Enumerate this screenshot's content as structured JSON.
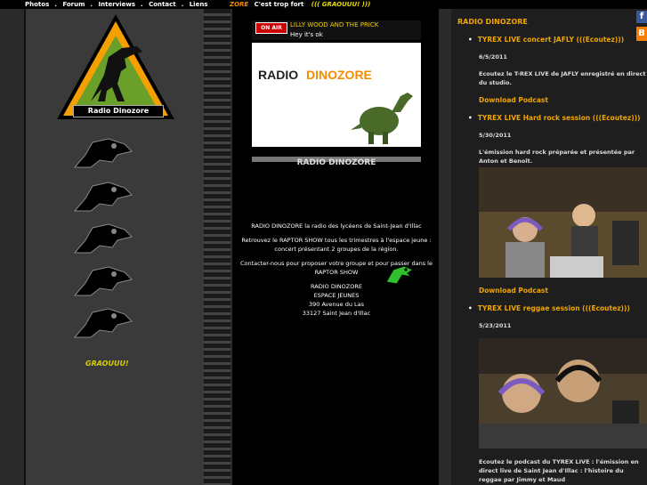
{
  "nav": {
    "items": [
      "Photos",
      "Forum",
      "Interviews",
      "Contact",
      "Liens"
    ],
    "separator": "."
  },
  "ticker": {
    "brand": "ZORE",
    "slogan": "C'est trop fort",
    "shout": "((( GRAOUUU! )))"
  },
  "left": {
    "logo_label": "Radio Dinozore",
    "graou": "GRAOUUU!"
  },
  "player": {
    "onair": "ON AIR",
    "track": "LILLY WOOD AND THE PRICK",
    "track_sub": "Hey it's ok"
  },
  "banner": {
    "word1": "RADIO",
    "word2": "DINOZORE",
    "caption": "RADIO DINOZORE"
  },
  "about": {
    "line1": "RADIO DINOZORE la radio des lycéens de Saint-Jean d'Illac",
    "line2": "Retrouvez le RAPTOR SHOW tous les trimestres à l'espace jeune : concert présentant 2 groupes de la région.",
    "line3": "Contacter-nous pour proposer votre groupe et pour passer dans le RAPTOR SHOW",
    "addr1": "RADIO DINOZORE",
    "addr2": "ESPACE JEUNES",
    "addr3": "390 Avenue du Las",
    "addr4": "33127 Saint Jean d'Illac"
  },
  "feed": {
    "title": "RADIO DINOZORE",
    "posts": [
      {
        "title": "TYREX LIVE concert JAFLY (((Ecoutez)))",
        "date": "6/5/2011",
        "text": "Ecoutez le T-REX LIVE de JAFLY enregistré en direct du studio.",
        "link": "Download Podcast"
      },
      {
        "title": "TYREX LIVE Hard rock session (((Ecoutez)))",
        "date": "5/30/2011",
        "text": "L'émission hard rock préparée et présentée par Anton et Benoît.",
        "link": "Download Podcast"
      },
      {
        "title": "TYREX LIVE reggae session (((Ecoutez)))",
        "date": "5/23/2011",
        "text": "Ecoutez le podcast du TYREX LIVE : l'émission en direct live de Saint Jean d'Illac : l'histoire du reggae par Jimmy et Maud"
      }
    ]
  },
  "social": {
    "fb": "f",
    "blogger": "B"
  },
  "colors": {
    "accent": "#f0a500",
    "onair": "#cc0000",
    "dino_green": "#4a6a2a"
  }
}
